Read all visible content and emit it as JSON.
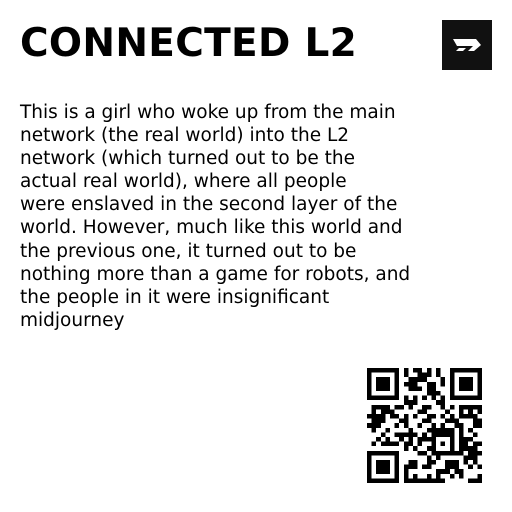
{
  "card": {
    "title": "CONNECTED L2",
    "description_lines": [
      "This is a girl who woke up from the main",
      "network (the real world) into the L2",
      "network (which turned out to be the",
      "actual real world), where all people",
      "were enslaved in the second layer of the",
      "world. However, much like this world and",
      "the previous one, it turned out to be",
      "nothing more than a game for robots, and",
      "the people in it were insignificant",
      "midjourney"
    ]
  },
  "logo": {
    "icon": "brand-logo-icon",
    "background": "#111111",
    "foreground": "#ffffff"
  },
  "qr_code": {
    "icon": "qr-code-icon"
  }
}
